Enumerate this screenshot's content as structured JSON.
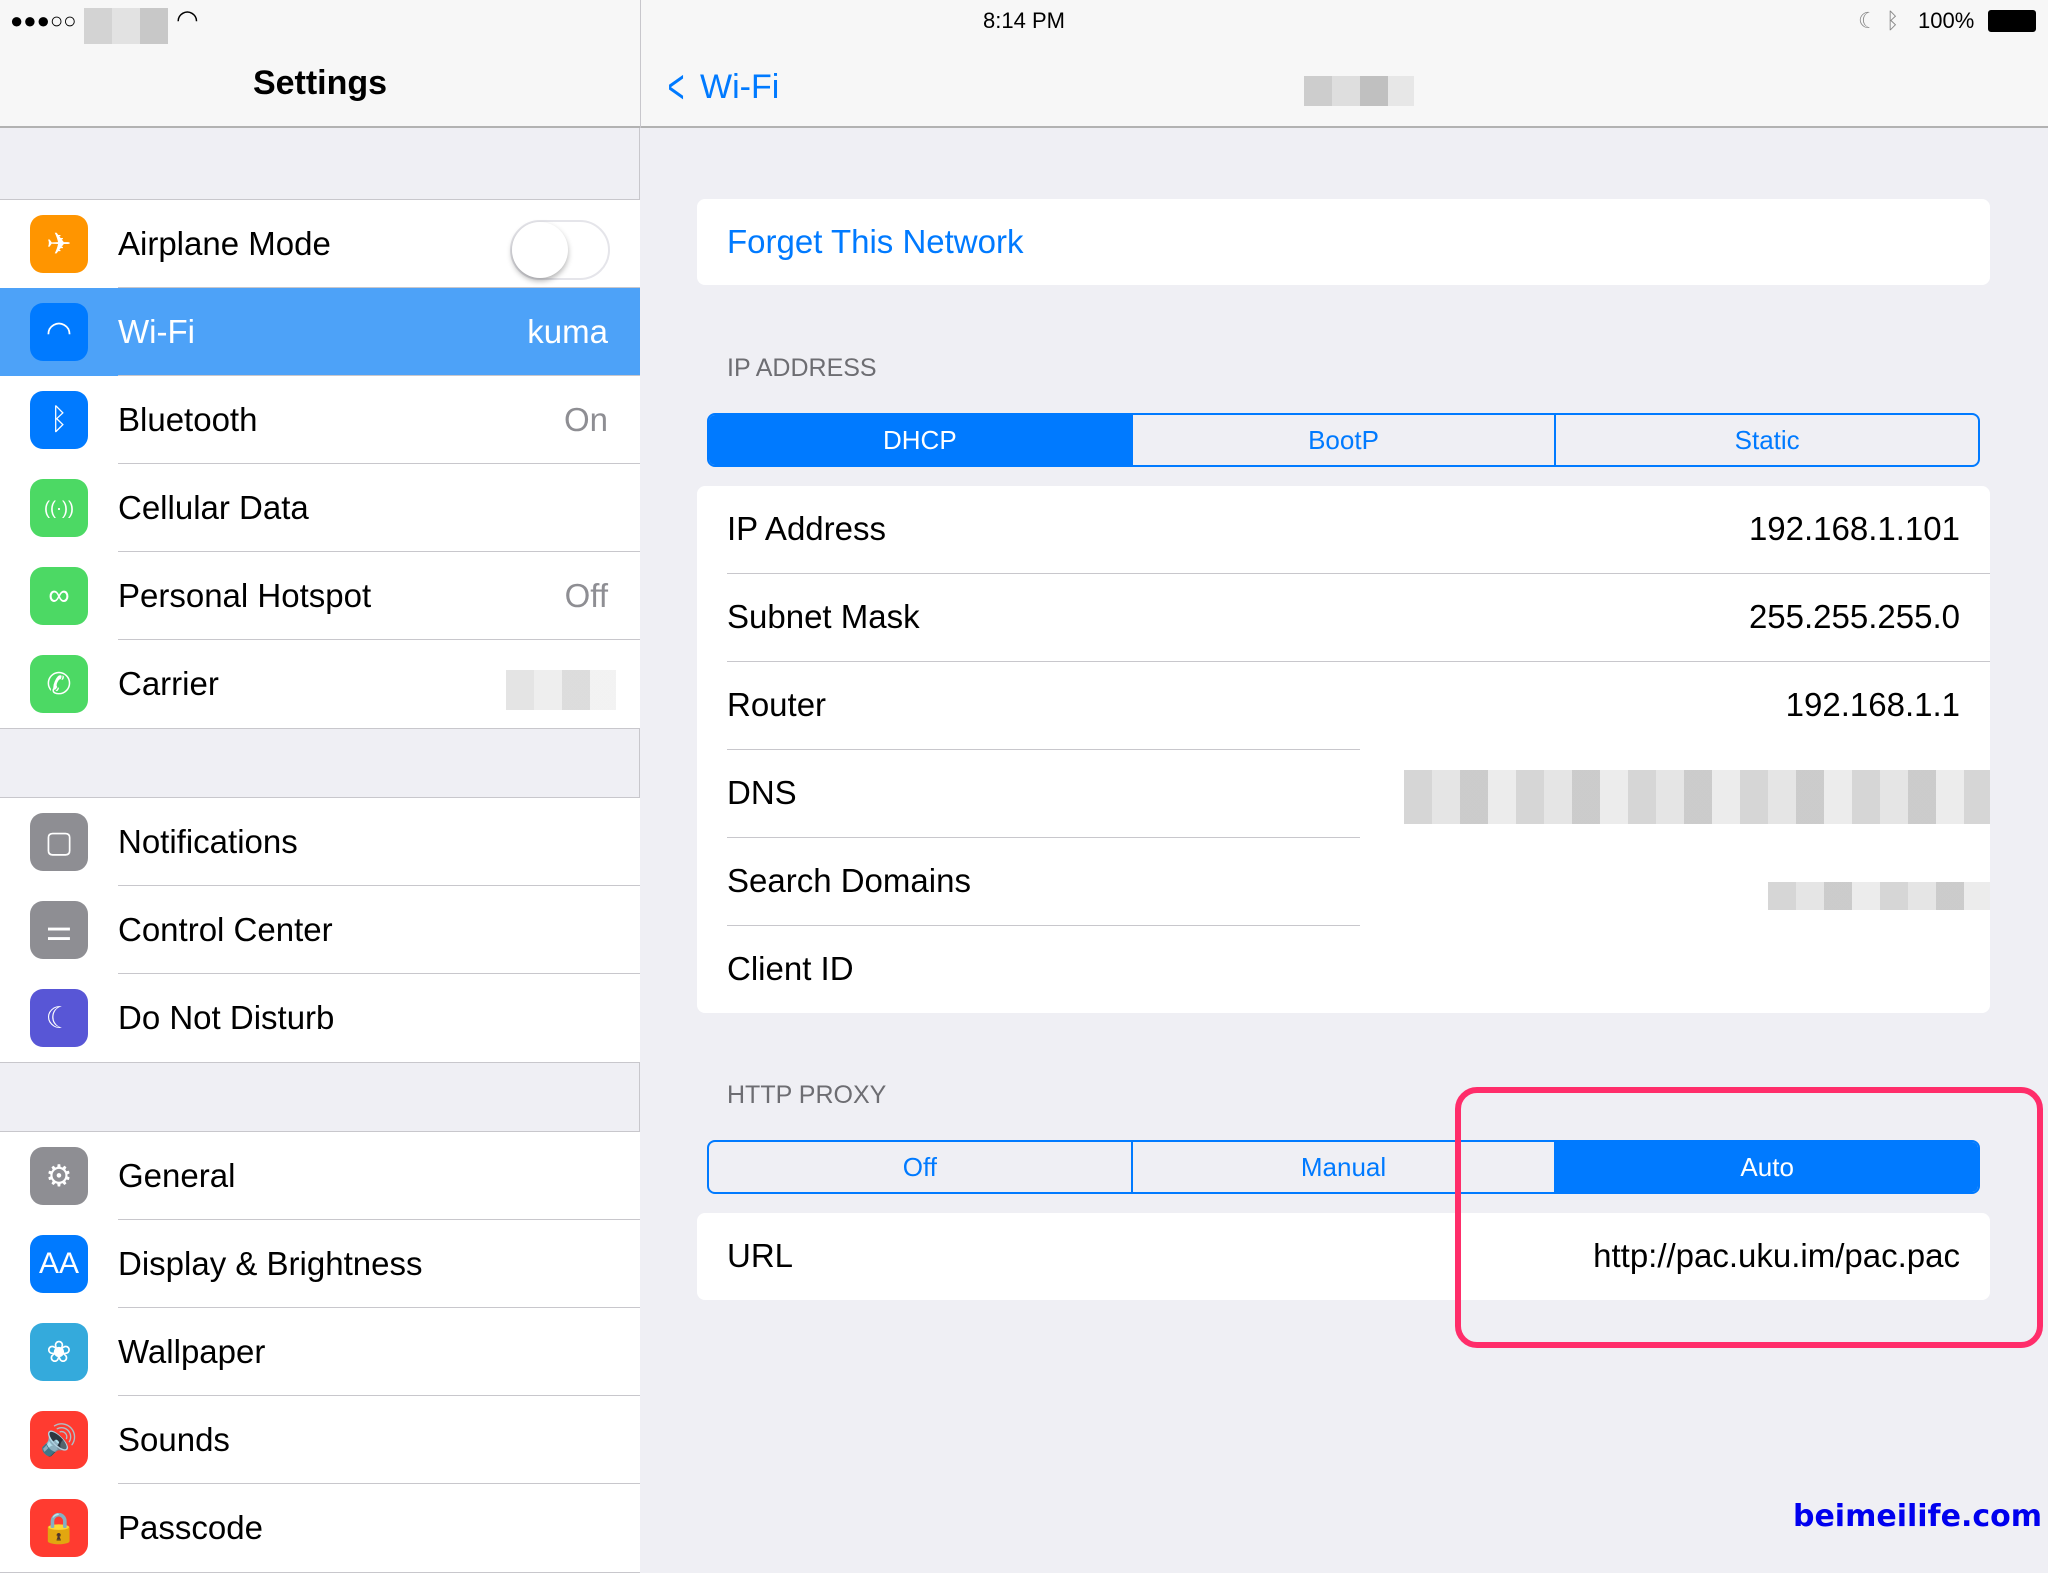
{
  "status_bar": {
    "signal": "●●●○○",
    "time": "8:14 PM",
    "battery": "100%"
  },
  "sidebar": {
    "title": "Settings",
    "groups": [
      [
        {
          "label": "Airplane Mode",
          "icon": "airplane-icon",
          "color": "#ff9500",
          "toggle": false
        },
        {
          "label": "Wi-Fi",
          "value": "kuma",
          "icon": "wifi-icon",
          "color": "#007aff",
          "selected": true
        },
        {
          "label": "Bluetooth",
          "value": "On",
          "icon": "bluetooth-icon",
          "color": "#007aff"
        },
        {
          "label": "Cellular Data",
          "icon": "cellular-icon",
          "color": "#4cd964"
        },
        {
          "label": "Personal Hotspot",
          "value": "Off",
          "icon": "hotspot-icon",
          "color": "#4cd964"
        },
        {
          "label": "Carrier",
          "icon": "phone-icon",
          "color": "#4cd964"
        }
      ],
      [
        {
          "label": "Notifications",
          "icon": "notifications-icon",
          "color": "#8e8e93"
        },
        {
          "label": "Control Center",
          "icon": "control-center-icon",
          "color": "#8e8e93"
        },
        {
          "label": "Do Not Disturb",
          "icon": "moon-icon",
          "color": "#5856d6"
        }
      ],
      [
        {
          "label": "General",
          "icon": "gear-icon",
          "color": "#8e8e93"
        },
        {
          "label": "Display & Brightness",
          "icon": "display-icon",
          "color": "#007aff"
        },
        {
          "label": "Wallpaper",
          "icon": "wallpaper-icon",
          "color": "#34aadc"
        },
        {
          "label": "Sounds",
          "icon": "sounds-icon",
          "color": "#ff3b30"
        },
        {
          "label": "Passcode",
          "icon": "lock-icon",
          "color": "#ff3b30"
        }
      ]
    ]
  },
  "detail": {
    "back_label": "Wi-Fi",
    "forget": "Forget This Network",
    "ip_header": "IP ADDRESS",
    "ip_modes": [
      "DHCP",
      "BootP",
      "Static"
    ],
    "ip_rows": [
      {
        "k": "IP Address",
        "v": "192.168.1.101"
      },
      {
        "k": "Subnet Mask",
        "v": "255.255.255.0"
      },
      {
        "k": "Router",
        "v": "192.168.1.1"
      },
      {
        "k": "DNS"
      },
      {
        "k": "Search Domains"
      },
      {
        "k": "Client ID"
      }
    ],
    "proxy_header": "HTTP PROXY",
    "proxy_modes": [
      "Off",
      "Manual",
      "Auto"
    ],
    "url_label": "URL",
    "url_value": "http://pac.uku.im/pac.pac"
  },
  "watermark": "beimeilife.com",
  "colors": {
    "accent": "#007aff",
    "highlight": "#ff2d6a"
  }
}
